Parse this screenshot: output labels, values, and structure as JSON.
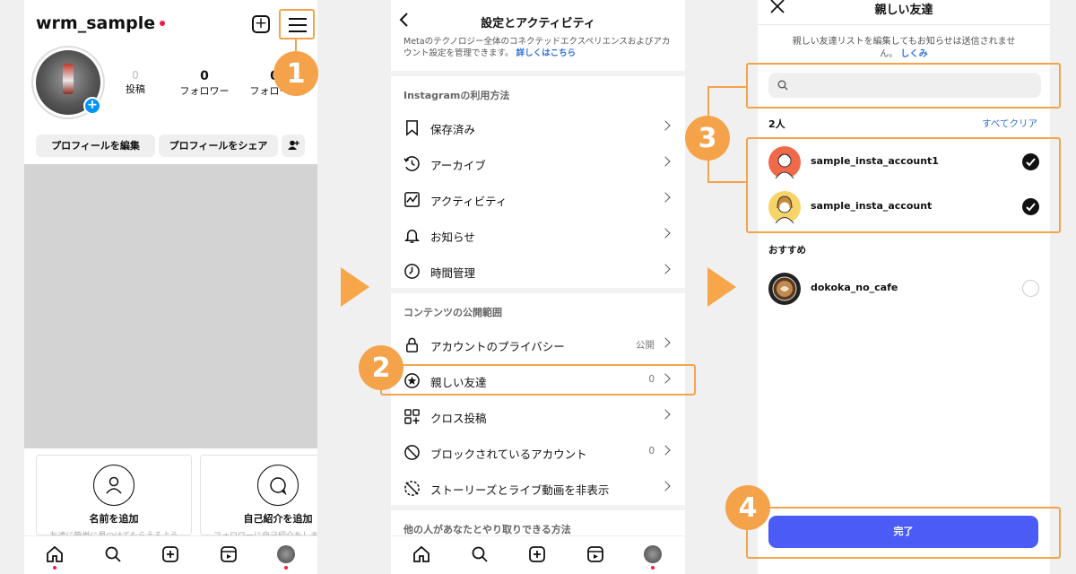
{
  "badges": [
    "1",
    "2",
    "3",
    "4"
  ],
  "profile": {
    "username": "wrm_sample",
    "stats": [
      {
        "num": "0",
        "label": "投稿"
      },
      {
        "num": "0",
        "label": "フォロワー"
      },
      {
        "num": "0",
        "label": "フォロー中"
      }
    ],
    "edit_button": "プロフィールを編集",
    "share_button": "プロフィールをシェア",
    "cards": [
      {
        "title": "名前を追加",
        "sub": "友達に簡単に見つけてもらえるよう"
      },
      {
        "title": "自己紹介を追加",
        "sub": "フォロワーに自己紹介をしましょう"
      }
    ]
  },
  "settings": {
    "title": "設定とアクティビティ",
    "description": "Metaのテクノロジー全体のコネクテッドエクスペリエンスおよびアカウント設定を管理できます。",
    "learn_more": "詳しくはこちら",
    "section1": "Instagramの利用方法",
    "rows1": [
      {
        "label": "保存済み",
        "icon": "bookmark-icon"
      },
      {
        "label": "アーカイブ",
        "icon": "archive-icon"
      },
      {
        "label": "アクティビティ",
        "icon": "activity-icon"
      },
      {
        "label": "お知らせ",
        "icon": "bell-icon"
      },
      {
        "label": "時間管理",
        "icon": "clock-icon"
      }
    ],
    "section2": "コンテンツの公開範囲",
    "rows2": [
      {
        "label": "アカウントのプライバシー",
        "value": "公開",
        "icon": "lock-icon"
      },
      {
        "label": "親しい友達",
        "value": "0",
        "icon": "star-circle-icon"
      },
      {
        "label": "クロス投稿",
        "value": "",
        "icon": "grid-plus-icon"
      },
      {
        "label": "ブロックされているアカウント",
        "value": "0",
        "icon": "block-icon"
      },
      {
        "label": "ストーリーズとライブ動画を非表示",
        "value": "",
        "icon": "hide-icon"
      }
    ],
    "section3": "他の人があなたとやり取りできる方法"
  },
  "close_friends": {
    "title": "親しい友達",
    "description": "親しい友達リストを編集してもお知らせは送信されません。",
    "learn_more": "しくみ",
    "search_placeholder": "",
    "count": "2人",
    "clear_all": "すべてクリア",
    "selected": [
      {
        "name": "sample_insta_account1",
        "checked": true
      },
      {
        "name": "sample_insta_account",
        "checked": true
      }
    ],
    "suggest_heading": "おすすめ",
    "suggested": [
      {
        "name": "dokoka_no_cafe",
        "checked": false
      }
    ],
    "done": "完了"
  },
  "colors": {
    "accent": "#f5a34a",
    "blue_button": "#4a5cf5",
    "link": "#2f6fd6",
    "notify_dot": "#ff1744"
  }
}
